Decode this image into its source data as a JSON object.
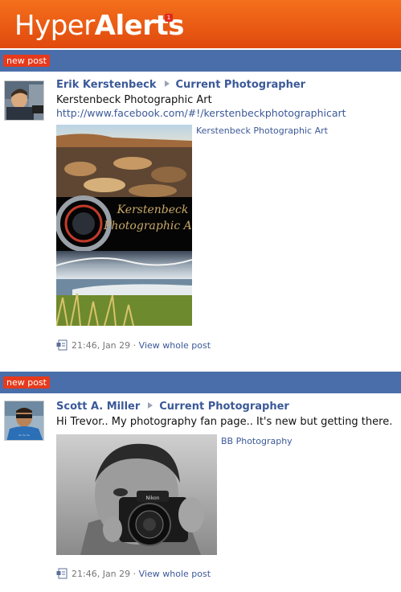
{
  "app": {
    "logo_light": "Hyper",
    "logo_bold": "Alerts",
    "badge_count": "1",
    "brand_color": "#e8571b",
    "bar_color": "#4a6ea9",
    "link_color": "#3b5998"
  },
  "posts": [
    {
      "tag": "new post",
      "author": "Erik Kerstenbeck",
      "target": "Current Photographer",
      "message": "Kerstenbeck Photographic Art",
      "link": "http://www.facebook.com/#!/kerstenbeckphotographicart",
      "attachment_caption": "Kerstenbeck Photographic Art",
      "image_text_line1": "Kerstenbeck",
      "image_text_line2": "Photographic Art",
      "timestamp": "21:46, Jan 29",
      "separator": "·",
      "view_label": "View whole post",
      "icon": "post-type-icon"
    },
    {
      "tag": "new post",
      "author": "Scott A. Miller",
      "target": "Current Photographer",
      "message": "Hi Trevor.. My photography fan page.. It's new but getting there.",
      "attachment_caption": "BB Photography",
      "timestamp": "21:46, Jan 29",
      "separator": "·",
      "view_label": "View whole post",
      "icon": "post-type-icon"
    }
  ]
}
